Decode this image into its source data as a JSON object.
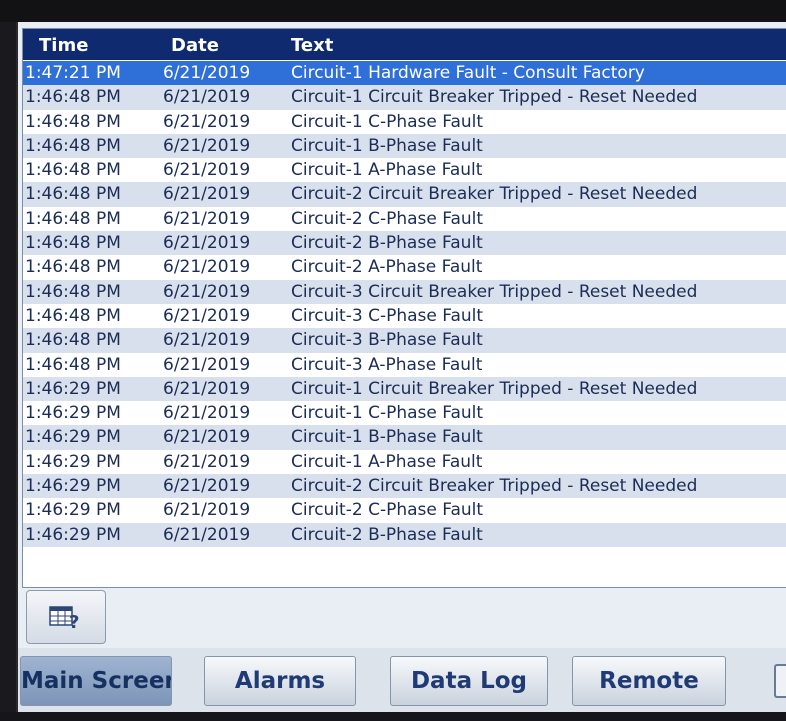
{
  "log": {
    "headers": {
      "time": "Time",
      "date": "Date",
      "text": "Text"
    },
    "rows": [
      {
        "time": "1:47:21 PM",
        "date": "6/21/2019",
        "text": "Circuit-1 Hardware Fault - Consult Factory"
      },
      {
        "time": "1:46:48 PM",
        "date": "6/21/2019",
        "text": "Circuit-1 Circuit Breaker Tripped - Reset Needed"
      },
      {
        "time": "1:46:48 PM",
        "date": "6/21/2019",
        "text": "Circuit-1 C-Phase Fault"
      },
      {
        "time": "1:46:48 PM",
        "date": "6/21/2019",
        "text": "Circuit-1 B-Phase Fault"
      },
      {
        "time": "1:46:48 PM",
        "date": "6/21/2019",
        "text": "Circuit-1 A-Phase Fault"
      },
      {
        "time": "1:46:48 PM",
        "date": "6/21/2019",
        "text": "Circuit-2 Circuit Breaker Tripped - Reset Needed"
      },
      {
        "time": "1:46:48 PM",
        "date": "6/21/2019",
        "text": "Circuit-2 C-Phase Fault"
      },
      {
        "time": "1:46:48 PM",
        "date": "6/21/2019",
        "text": "Circuit-2 B-Phase Fault"
      },
      {
        "time": "1:46:48 PM",
        "date": "6/21/2019",
        "text": "Circuit-2 A-Phase Fault"
      },
      {
        "time": "1:46:48 PM",
        "date": "6/21/2019",
        "text": "Circuit-3 Circuit Breaker Tripped - Reset Needed"
      },
      {
        "time": "1:46:48 PM",
        "date": "6/21/2019",
        "text": "Circuit-3 C-Phase Fault"
      },
      {
        "time": "1:46:48 PM",
        "date": "6/21/2019",
        "text": "Circuit-3 B-Phase Fault"
      },
      {
        "time": "1:46:48 PM",
        "date": "6/21/2019",
        "text": "Circuit-3 A-Phase Fault"
      },
      {
        "time": "1:46:29 PM",
        "date": "6/21/2019",
        "text": "Circuit-1 Circuit Breaker Tripped - Reset Needed"
      },
      {
        "time": "1:46:29 PM",
        "date": "6/21/2019",
        "text": "Circuit-1 C-Phase Fault"
      },
      {
        "time": "1:46:29 PM",
        "date": "6/21/2019",
        "text": "Circuit-1 B-Phase Fault"
      },
      {
        "time": "1:46:29 PM",
        "date": "6/21/2019",
        "text": "Circuit-1 A-Phase Fault"
      },
      {
        "time": "1:46:29 PM",
        "date": "6/21/2019",
        "text": "Circuit-2 Circuit Breaker Tripped - Reset Needed"
      },
      {
        "time": "1:46:29 PM",
        "date": "6/21/2019",
        "text": "Circuit-2 C-Phase Fault"
      },
      {
        "time": "1:46:29 PM",
        "date": "6/21/2019",
        "text": "Circuit-2 B-Phase Fault"
      }
    ],
    "selected_row": 0
  },
  "help_button": {
    "icon": "table-help-icon"
  },
  "nav": {
    "main_screen": "Main Screen",
    "alarms": "Alarms",
    "data_log": "Data Log",
    "remote": "Remote"
  },
  "colors": {
    "header_bg": "#0f2a6e",
    "selected_row": "#2f6fd8",
    "text": "#1c2c55"
  }
}
